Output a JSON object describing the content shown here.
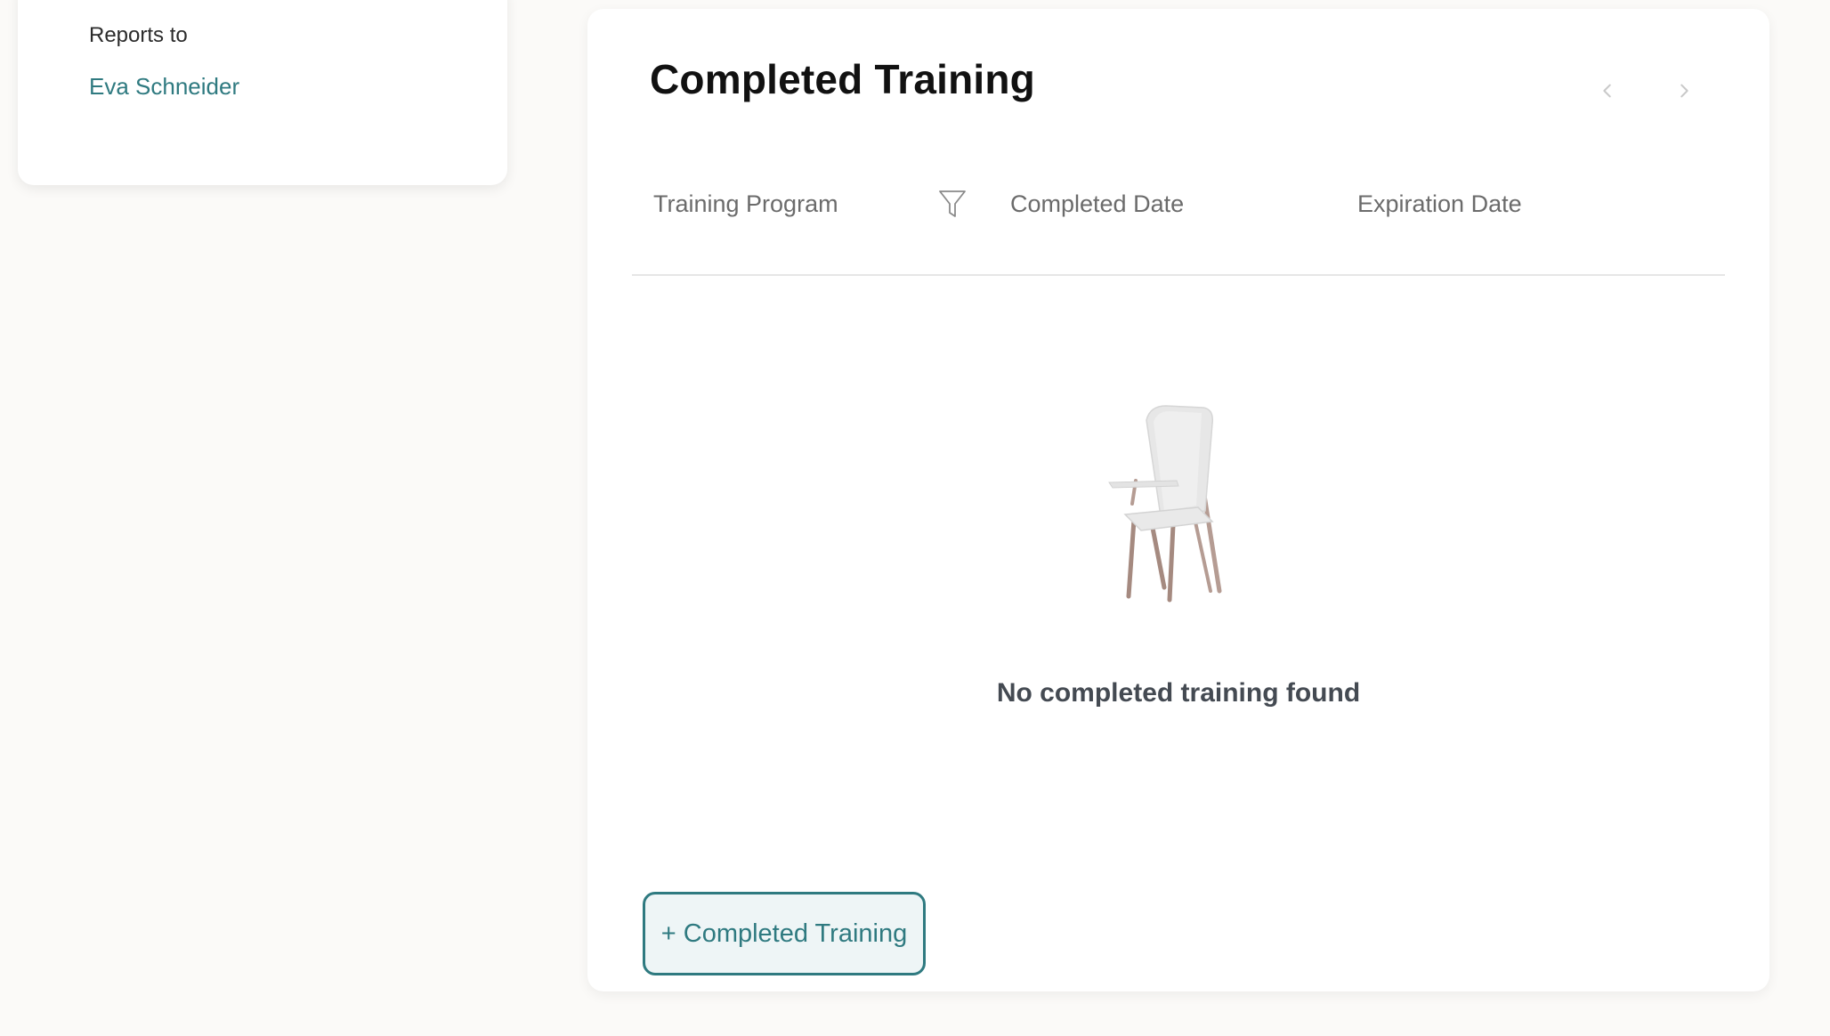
{
  "manager_card": {
    "label": "Reports to",
    "manager_name": "Eva Schneider"
  },
  "training_card": {
    "title": "Completed Training",
    "pager": {
      "prev_icon": "chevron-left-icon",
      "next_icon": "chevron-right-icon"
    },
    "columns": [
      {
        "label": "Training Program",
        "filter_icon": "filter-icon"
      },
      {
        "label": "Completed Date"
      },
      {
        "label": "Expiration Date"
      }
    ],
    "rows": [],
    "empty_state": {
      "illustration": "chair-illustration",
      "message": "No completed training found"
    },
    "add_button_label": "+ Completed Training"
  },
  "colors": {
    "page_background": "#fbfaf8",
    "card_background": "#ffffff",
    "accent": "#2f7a80",
    "accent_light_bg": "#eef5f6",
    "muted_text": "#6b6b6b",
    "empty_text": "#444a52"
  }
}
